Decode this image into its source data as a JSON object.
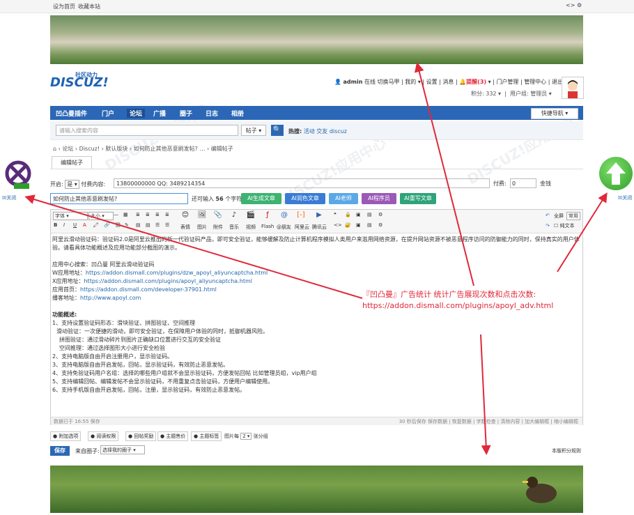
{
  "topbar": {
    "home": "设为首页",
    "favorite": "收藏本站"
  },
  "logo": {
    "main": "DISCUZ!",
    "sub": "社区动力"
  },
  "userbar": {
    "username": "admin",
    "online": "在线",
    "switch": "切换马甲",
    "my": "我的",
    "settings": "设置",
    "messages": "消息",
    "alerts": "提醒(3)",
    "portal_manage": "门户管理",
    "admin_center": "管理中心",
    "logout": "退出",
    "points": "积分: 332",
    "usergroup": "用户组: 管理员"
  },
  "nav": {
    "items": [
      "凹凸曼插件",
      "门户",
      "论坛",
      "广播",
      "圈子",
      "日志",
      "相册"
    ],
    "quick": "快捷导航"
  },
  "search": {
    "placeholder": "请输入搜索内容",
    "type": "帖子",
    "hot_label": "热搜:",
    "hot_items": [
      "活动",
      "交友",
      "discuz"
    ]
  },
  "breadcrumb": "论坛 › Discuz! › 默认版块 › 如何防止其他恶意刷发帖? … › 编辑帖子",
  "tab": "编辑帖子",
  "form": {
    "open_label": "开启:",
    "open_value": "是",
    "paid_label": "付费内容:",
    "paid_value": "13800000000  QQ: 3489214354",
    "price_label": "付费:",
    "price_value": "0",
    "price_unit": "金钱",
    "title_value": "如何防止其他恶意刷发帖?",
    "title_count_prefix": "还可输入",
    "title_count": "56",
    "title_count_suffix": "个字符",
    "ai_buttons": [
      {
        "label": "AI生成文章",
        "color": "#3cb371"
      },
      {
        "label": "AI润色文章",
        "color": "#3a7bd5"
      },
      {
        "label": "AI老师",
        "color": "#5aa9e6"
      },
      {
        "label": "AI程序员",
        "color": "#9b59b6"
      },
      {
        "label": "AI重写文章",
        "color": "#2fa37a"
      }
    ]
  },
  "toolbar": {
    "font": "字体",
    "size": "大小",
    "labels": [
      "表情",
      "图片",
      "附件",
      "音乐",
      "视频",
      "Flash",
      "@朋友",
      "阿里云",
      "腾讯云"
    ],
    "fullscreen": "全屏",
    "common": "常用",
    "plaintext": "纯文本"
  },
  "content": {
    "intro": "阿里云滑动验证码：验证码2.0是阿里云推出的新一代验证码产品，即可安全验证，能够缓解及防止计算机程序模拟人类用户来滥用网络资源，在提升网站资源不被恶意程序访问的防御能力的同时，保持真实的用户体验。请看具体功能概述及应用功能部分截图的演示。",
    "search_line": "应用中心搜索：凹凸曼 阿里云滑动验证码",
    "links": [
      {
        "label": "W应用地址：",
        "url": "https://addon.dismall.com/plugins/dzw_apoyl_aliyuncaptcha.html"
      },
      {
        "label": "X应用地址：",
        "url": "https://addon.dismall.com/plugins/apoyl_aliyuncaptcha.html"
      },
      {
        "label": "应用首页：",
        "url": "https://addon.dismall.com/developer-37901.html"
      },
      {
        "label": "播客地址：",
        "url": "http://www.apoyl.com"
      }
    ],
    "overview_title": "功能概述:",
    "features": [
      "1、支持设置验证码形态：滑块验证、拼图验证、空间推理",
      "滑动验证：一次便捷的滑动，即可安全验证，在保障用户体验的同时，抵御机器风险。",
      "拼图验证：通过滑动碎片到图片正确缺口位置进行交互的安全验证",
      "空间推理：通过选择图形大小进行安全检验",
      "2、支持电脑版自由开启注册用户，显示验证码。",
      "3、支持电脑版自由开启发帖，回帖，显示验证码，有效防止恶意发帖。",
      "4、支持免验证码用户名组：选择的哪些用户组就不会显示验证码，方便发帖回帖 比如管理员组，vip用户组",
      "5、支持编辑回帖、编辑发帖不会显示验证码，不用重复点击验证码，方便用户编辑使用。",
      "6、支持手机版自由开启发帖，回帖，注册，显示验证码，有效防止恶意发帖。"
    ]
  },
  "statusbar": {
    "left": "数据已于 16:55 保存",
    "right": "30 秒后保存 保存数据 | 恢复数据 | 字数检查 | 清除内容 | 加大编辑框 | 缩小编辑框"
  },
  "options": {
    "items": [
      "附加选项",
      "阅读权限",
      "回帖奖励",
      "主题售价",
      "主题标签"
    ],
    "images_per_page": "图片每",
    "images_value": "2",
    "images_suffix": "张分组"
  },
  "save": {
    "button": "保存",
    "from_label": "来自圈子:",
    "from_select": "选择我的圈子",
    "rules": "本版积分规则"
  },
  "floaters": {
    "left_close": "关闭",
    "right_close": "关闭"
  },
  "annotation": "『凹凸曼』广告统计 统计广告展现次数和点击次数: https://addon.dismall.com/plugins/apoyl_adv.html",
  "colors": {
    "nav": "#2b67b6",
    "arrow": "#e0283a"
  }
}
